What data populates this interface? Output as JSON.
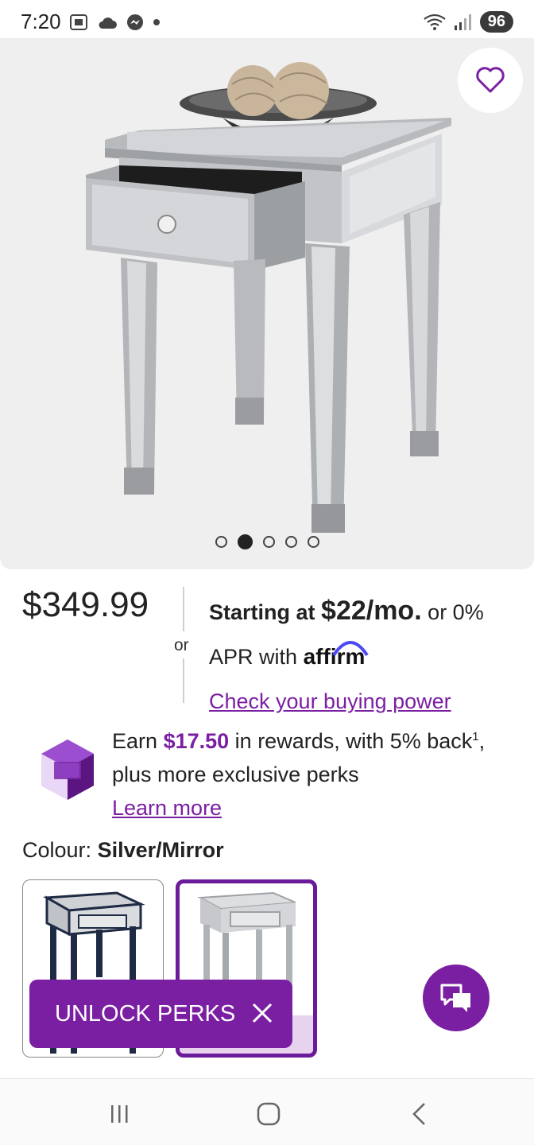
{
  "status_bar": {
    "time": "7:20",
    "left_icons": [
      "screenshot-icon",
      "cloud-icon",
      "messenger-icon",
      "dot-icon"
    ],
    "right_icons": [
      "wifi-icon",
      "signal-icon"
    ],
    "battery": "96"
  },
  "product": {
    "image_alt": "mirrored end table with open drawer",
    "favorite_icon": "heart-icon",
    "carousel": {
      "count": 5,
      "active_index": 1
    }
  },
  "pricing": {
    "price": "$349.99",
    "or_label": "or",
    "starting_at": "Starting at",
    "monthly": "$22/mo.",
    "apr_suffix": "or 0%",
    "apr_line": "APR with",
    "affirm": "affirm",
    "buying_power_link": "Check your buying power"
  },
  "rewards": {
    "earn": "Earn",
    "amount": "$17.50",
    "text_mid": "in rewards, with 5% back",
    "superscript": "1",
    "text_end": ",",
    "line2": "plus more exclusive perks",
    "learn_more": "Learn more"
  },
  "colour": {
    "label": "Colour:",
    "selected": "Silver/Mirror",
    "options": [
      "Black/Mirror",
      "Silver/Mirror"
    ],
    "selected_index": 1
  },
  "perks_banner": {
    "label": "UNLOCK PERKS"
  },
  "chat": {
    "icon": "chat-bubbles-icon"
  },
  "colors": {
    "accent": "#7b1fa2",
    "accent_light": "#e7d3ee",
    "hero_bg": "#efefef"
  },
  "nav": {
    "icons": [
      "recent-apps-icon",
      "home-icon",
      "back-icon"
    ]
  }
}
